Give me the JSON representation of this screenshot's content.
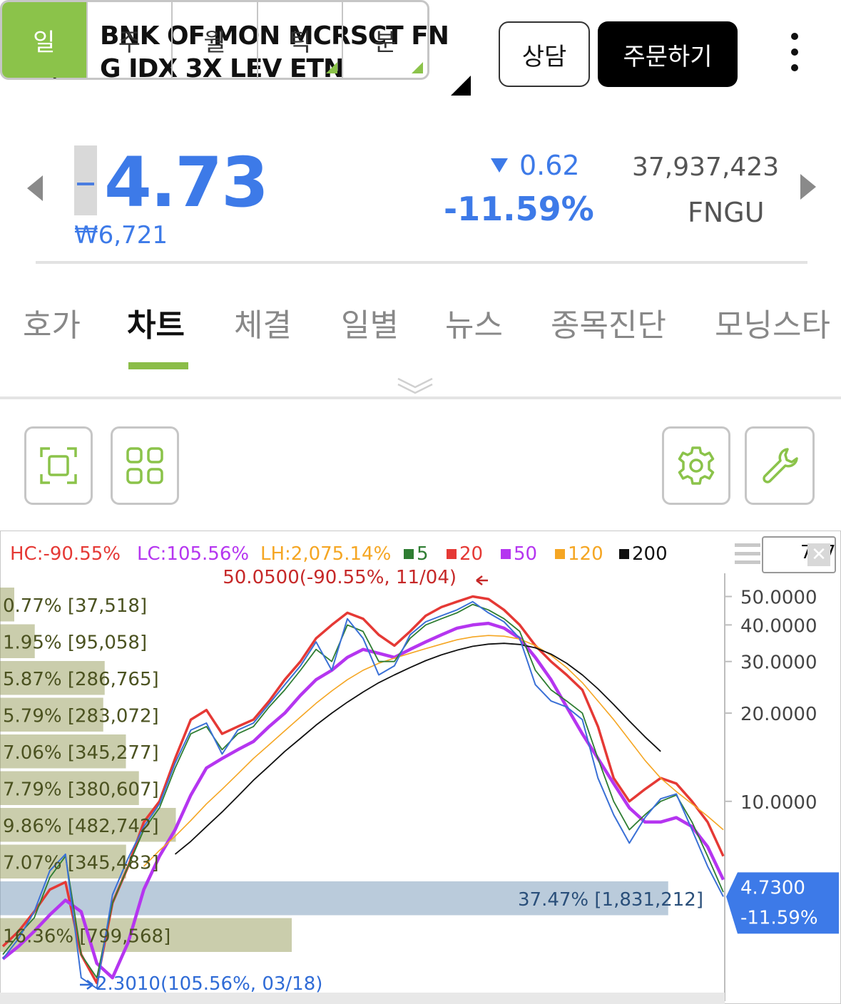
{
  "header": {
    "title": "BNK OF MON MCRSCT FN G IDX 3X LEV ETN",
    "consult_label": "상담",
    "order_label": "주문하기"
  },
  "quote": {
    "price": "4.73",
    "krw": "₩6,721",
    "change": "0.62",
    "change_pct": "-11.59%",
    "volume": "37,937,423",
    "ticker": "FNGU",
    "color": "#3d7ae8"
  },
  "tabs": [
    {
      "label": "호가"
    },
    {
      "label": "차트",
      "active": true
    },
    {
      "label": "체결"
    },
    {
      "label": "일별"
    },
    {
      "label": "뉴스"
    },
    {
      "label": "종목진단"
    },
    {
      "label": "모닝스타"
    }
  ],
  "periods": [
    {
      "label": "일",
      "active": true
    },
    {
      "label": "주"
    },
    {
      "label": "월"
    },
    {
      "label": "틱",
      "has_menu": true
    },
    {
      "label": "분",
      "has_menu": true
    }
  ],
  "chart": {
    "legend": {
      "hc": "HC:-90.55%",
      "lc": "LC:105.56%",
      "lh": "LH:2,075.14%",
      "ma": [
        {
          "label": "5",
          "color": "#2e7d32"
        },
        {
          "label": "20",
          "color": "#e53935"
        },
        {
          "label": "50",
          "color": "#b535f0"
        },
        {
          "label": "120",
          "color": "#f5a623"
        },
        {
          "label": "200",
          "color": "#111111"
        }
      ]
    },
    "count": "757",
    "high_label": "50.0500(-90.55%, 11/04)",
    "low_label": "2.3010(105.56%, 03/18)",
    "current_price": "4.7300",
    "current_pct": "-11.59%",
    "current_color": "#3d7ae8",
    "y_ticks": [
      "50.0000",
      "40.0000",
      "30.0000",
      "20.0000",
      "10.0000"
    ],
    "volume_profile": [
      {
        "label": "0.77% [37,518]",
        "pct": 0.77
      },
      {
        "label": "1.95% [95,058]",
        "pct": 1.95
      },
      {
        "label": "5.87% [286,765]",
        "pct": 5.87
      },
      {
        "label": "5.79% [283,072]",
        "pct": 5.79
      },
      {
        "label": "7.06% [345,277]",
        "pct": 7.06
      },
      {
        "label": "7.79% [380,607]",
        "pct": 7.79
      },
      {
        "label": "9.86% [482,742]",
        "pct": 9.86
      },
      {
        "label": "7.07% [345,483]",
        "pct": 7.07
      },
      {
        "label": "37.47% [1,831,212]",
        "pct": 37.47,
        "highlight": true
      },
      {
        "label": "16.36% [799,568]",
        "pct": 16.36
      }
    ]
  },
  "chart_data": {
    "type": "line",
    "title": "",
    "scale": "log",
    "ylim": [
      2.2,
      60
    ],
    "series": [
      {
        "name": "20",
        "color": "#e53935",
        "values": [
          3.2,
          3.6,
          4.2,
          5.0,
          5.3,
          3.0,
          2.4,
          4.5,
          6.0,
          8.5,
          10.0,
          14.0,
          19.0,
          20.5,
          17.0,
          18.0,
          19.0,
          22.0,
          26.0,
          30.0,
          36.0,
          40.0,
          44.0,
          42.0,
          37.0,
          34.0,
          38.0,
          43.0,
          46.0,
          48.0,
          50.0,
          49.0,
          45.0,
          40.0,
          34.0,
          30.0,
          27.0,
          24.0,
          18.0,
          12.0,
          10.0,
          11.0,
          12.0,
          11.5,
          10.0,
          8.5,
          6.5
        ]
      },
      {
        "name": "50",
        "color": "#b535f0",
        "values": [
          2.9,
          3.2,
          3.6,
          4.1,
          4.6,
          4.2,
          2.8,
          2.5,
          3.3,
          5.0,
          6.5,
          8.0,
          10.5,
          13.0,
          14.0,
          15.0,
          16.0,
          18.0,
          20.0,
          23.0,
          26.0,
          28.0,
          31.0,
          33.0,
          32.0,
          31.0,
          33.0,
          35.0,
          37.0,
          39.0,
          40.0,
          40.5,
          39.0,
          36.0,
          31.0,
          26.0,
          21.0,
          17.0,
          14.0,
          11.5,
          9.5,
          8.5,
          8.5,
          8.8,
          8.2,
          7.0,
          5.4
        ]
      },
      {
        "name": "120",
        "color": "#f5a623",
        "values": [
          null,
          null,
          null,
          null,
          null,
          null,
          null,
          null,
          null,
          6.0,
          6.8,
          7.6,
          8.6,
          9.8,
          11.0,
          12.4,
          14.0,
          15.6,
          17.4,
          19.4,
          21.6,
          23.8,
          26.0,
          28.0,
          29.6,
          30.8,
          32.0,
          33.2,
          34.4,
          35.6,
          36.4,
          36.8,
          36.6,
          35.8,
          34.0,
          31.5,
          28.6,
          25.4,
          22.0,
          19.0,
          16.2,
          13.8,
          12.0,
          10.8,
          9.8,
          8.9,
          8.0
        ]
      },
      {
        "name": "200",
        "color": "#111111",
        "values": [
          null,
          null,
          null,
          null,
          null,
          null,
          null,
          null,
          null,
          null,
          null,
          6.6,
          7.3,
          8.2,
          9.2,
          10.4,
          11.8,
          13.2,
          14.8,
          16.4,
          18.2,
          20.0,
          21.8,
          23.6,
          25.4,
          27.0,
          28.6,
          30.2,
          31.6,
          32.8,
          33.8,
          34.4,
          34.6,
          34.3,
          33.4,
          31.8,
          29.6,
          27.0,
          24.2,
          21.4,
          18.8,
          16.6,
          14.8,
          null,
          null,
          null,
          null
        ]
      },
      {
        "name": "5",
        "color": "#2e7d32",
        "values": [
          3.0,
          3.5,
          4.0,
          5.5,
          6.5,
          3.0,
          2.5,
          4.5,
          6.0,
          8.0,
          9.5,
          13.0,
          17.0,
          18.0,
          15.0,
          17.0,
          18.0,
          21.0,
          24.0,
          28.0,
          33.0,
          30.0,
          40.0,
          38.0,
          30.0,
          30.0,
          36.0,
          40.0,
          42.0,
          44.0,
          47.0,
          45.0,
          42.0,
          38.0,
          28.0,
          24.0,
          22.0,
          20.0,
          14.0,
          10.0,
          8.0,
          9.0,
          10.0,
          10.5,
          8.5,
          6.5,
          4.9
        ]
      },
      {
        "name": "price",
        "color": "#3a70d6",
        "values": [
          2.9,
          3.4,
          4.2,
          5.8,
          6.6,
          2.5,
          2.3,
          4.8,
          6.4,
          8.2,
          9.8,
          13.5,
          17.5,
          18.5,
          14.5,
          17.5,
          18.5,
          21.5,
          25.0,
          29.0,
          35.0,
          28.0,
          42.0,
          36.0,
          27.0,
          29.0,
          37.0,
          41.0,
          43.0,
          45.0,
          48.0,
          44.0,
          41.0,
          36.0,
          25.0,
          22.0,
          21.0,
          19.0,
          12.0,
          9.0,
          7.2,
          8.8,
          10.2,
          10.6,
          8.0,
          6.0,
          4.73
        ]
      }
    ],
    "annotations": [
      {
        "text": "50.0500(-90.55%, 11/04)",
        "y": 50.05
      },
      {
        "text": "2.3010(105.56%, 03/18)",
        "y": 2.301
      }
    ]
  }
}
